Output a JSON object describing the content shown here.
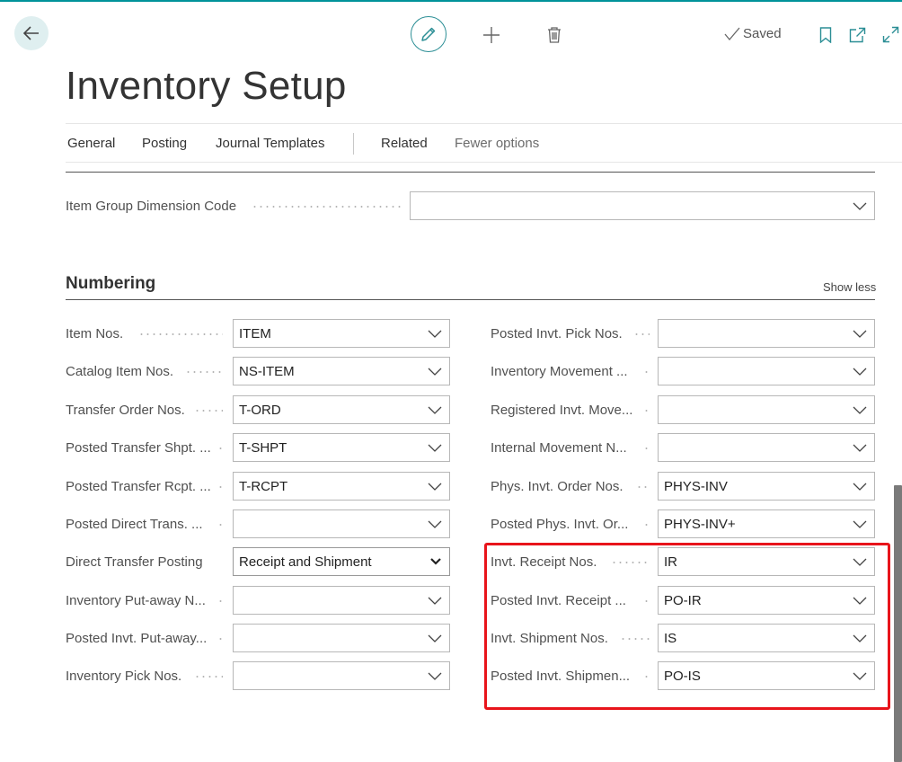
{
  "toolbar": {
    "saved_label": "Saved"
  },
  "page": {
    "title": "Inventory Setup"
  },
  "nav": {
    "items": [
      "General",
      "Posting",
      "Journal Templates",
      "Related",
      "Fewer options"
    ]
  },
  "item_group_dimension": {
    "label": "Item Group Dimension Code",
    "value": ""
  },
  "numbering": {
    "title": "Numbering",
    "show_less": "Show less",
    "left": [
      {
        "label": "Item Nos.",
        "value": "ITEM"
      },
      {
        "label": "Catalog Item Nos.",
        "value": "NS-ITEM"
      },
      {
        "label": "Transfer Order Nos.",
        "value": "T-ORD"
      },
      {
        "label": "Posted Transfer Shpt. ...",
        "value": "T-SHPT"
      },
      {
        "label": "Posted Transfer Rcpt. ...",
        "value": "T-RCPT"
      },
      {
        "label": "Posted Direct Trans. ...",
        "value": ""
      },
      {
        "label": "Direct Transfer Posting",
        "value": "Receipt and Shipment"
      },
      {
        "label": "Inventory Put-away N...",
        "value": ""
      },
      {
        "label": "Posted Invt. Put-away...",
        "value": ""
      },
      {
        "label": "Inventory Pick Nos.",
        "value": ""
      }
    ],
    "right": [
      {
        "label": "Posted Invt. Pick Nos.",
        "value": ""
      },
      {
        "label": "Inventory Movement ...",
        "value": ""
      },
      {
        "label": "Registered Invt. Move...",
        "value": ""
      },
      {
        "label": "Internal Movement N...",
        "value": ""
      },
      {
        "label": "Phys. Invt. Order Nos.",
        "value": "PHYS-INV"
      },
      {
        "label": "Posted Phys. Invt. Or...",
        "value": "PHYS-INV+"
      },
      {
        "label": "Invt. Receipt Nos.",
        "value": "IR"
      },
      {
        "label": "Posted Invt. Receipt ...",
        "value": "PO-IR"
      },
      {
        "label": "Invt. Shipment Nos.",
        "value": "IS"
      },
      {
        "label": "Posted Invt. Shipmen...",
        "value": "PO-IS"
      }
    ]
  },
  "colors": {
    "accent": "#00939a",
    "highlight": "#e8141b"
  }
}
